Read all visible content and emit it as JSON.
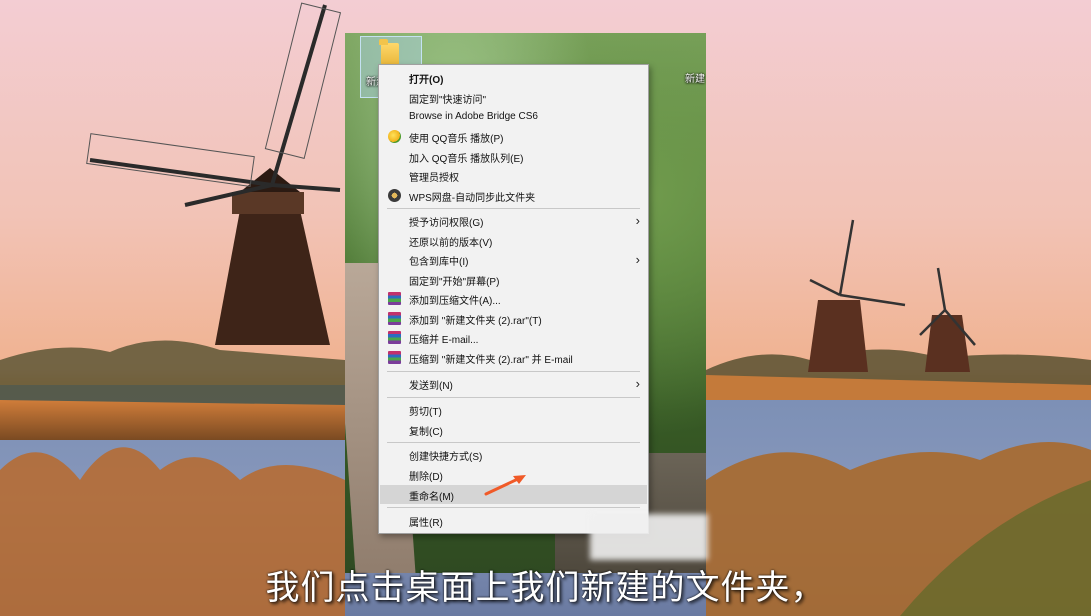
{
  "desktop": {
    "folder_label_left": "新建",
    "folder_label_right": "新建"
  },
  "context_menu": {
    "items": [
      {
        "label": "打开(O)",
        "icon": "none"
      },
      {
        "label": "固定到\"快速访问\"",
        "icon": "none"
      },
      {
        "label": "Browse in Adobe Bridge CS6",
        "icon": "none"
      },
      {
        "label": "使用 QQ音乐 播放(P)",
        "icon": "qq-music-icon"
      },
      {
        "label": "加入 QQ音乐 播放队列(E)",
        "icon": "none"
      },
      {
        "label": "管理员授权",
        "icon": "none"
      },
      {
        "label": "WPS网盘-自动同步此文件夹",
        "icon": "wps-cloud-icon"
      },
      {
        "label": "授予访问权限(G)",
        "icon": "none",
        "submenu": true
      },
      {
        "label": "还原以前的版本(V)",
        "icon": "none"
      },
      {
        "label": "包含到库中(I)",
        "icon": "none",
        "submenu": true
      },
      {
        "label": "固定到\"开始\"屏幕(P)",
        "icon": "none"
      },
      {
        "label": "添加到压缩文件(A)...",
        "icon": "winrar-icon"
      },
      {
        "label": "添加到 \"新建文件夹 (2).rar\"(T)",
        "icon": "winrar-icon"
      },
      {
        "label": "压缩并 E-mail...",
        "icon": "winrar-icon"
      },
      {
        "label": "压缩到 \"新建文件夹 (2).rar\" 并 E-mail",
        "icon": "winrar-icon"
      },
      {
        "label": "发送到(N)",
        "icon": "none",
        "submenu": true
      },
      {
        "label": "剪切(T)",
        "icon": "none"
      },
      {
        "label": "复制(C)",
        "icon": "none"
      },
      {
        "label": "创建快捷方式(S)",
        "icon": "none"
      },
      {
        "label": "删除(D)",
        "icon": "none"
      },
      {
        "label": "重命名(M)",
        "icon": "none",
        "highlighted": true
      },
      {
        "label": "属性(R)",
        "icon": "none"
      }
    ]
  },
  "subtitle": "我们点击桌面上我们新建的文件夹，",
  "colors": {
    "menu_background": "#f2f2f2",
    "menu_hover": "#d5d5d5",
    "arrow": "#f05a28"
  }
}
